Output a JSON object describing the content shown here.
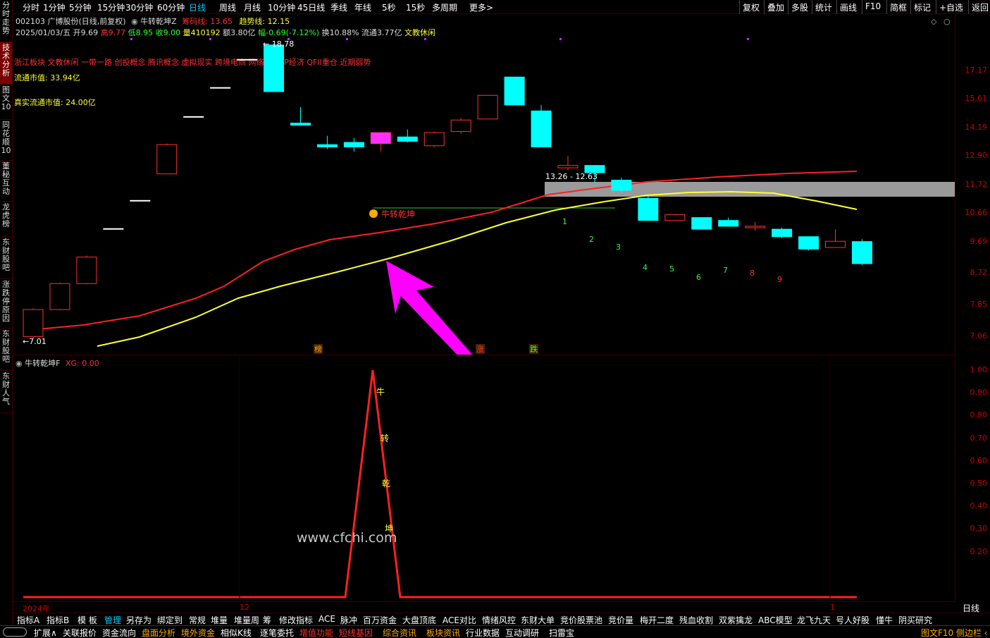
{
  "sidebar": {
    "items": [
      {
        "label": "分时走势",
        "active": false
      },
      {
        "label": "技术分析",
        "active": true
      },
      {
        "label": "图文10",
        "active": false
      },
      {
        "label": "同花顺10",
        "active": false
      },
      {
        "label": "董秘互动",
        "active": false
      },
      {
        "label": "龙虎榜",
        "active": false
      },
      {
        "label": "东财股吧",
        "active": false
      },
      {
        "label": "涨跌停原因",
        "active": false
      },
      {
        "label": "东财股吧",
        "active": false
      },
      {
        "label": "东财人气",
        "active": false
      }
    ]
  },
  "topbar": {
    "periods": [
      "分时",
      "1分钟",
      "5分钟",
      "15分钟",
      "30分钟",
      "60分钟",
      "日线",
      "周线",
      "月线",
      "10分钟",
      "45日线",
      "季线",
      "年线",
      "5秒",
      "15秒",
      "多周期",
      "更多>"
    ],
    "active_period": "日线",
    "right_buttons": [
      "复权",
      "叠加",
      "多股",
      "统计",
      "画线",
      "F10",
      "简框",
      "标记",
      "+自选",
      "返回"
    ]
  },
  "header": {
    "stock": "002103 广博股份(日线,前复权)",
    "indicator_name": "牛转乾坤Z",
    "chip_label": "筹码线: 13.65",
    "trend_label": "趋势线: 12.15",
    "date": "2025/01/03/五",
    "open": "开9.69",
    "high": "高9.77",
    "low": "低8.95",
    "close": "收9.00",
    "volume": "量410192",
    "amount": "额3.80亿",
    "change": "幅-0.69(-7.12%)",
    "turnover": "换10.88%",
    "float": "流通3.77亿",
    "tag": "文教休闲",
    "concepts": "浙江板块 文教休闲 一带一路 创投概念 腾讯概念 虚拟现实 跨境电商 网络概念 IP经济 QFII重仓 近期弱势",
    "float_mv": "流通市值: 33.94亿",
    "real_float_mv": "真实流通市值: 24.00亿"
  },
  "annotations": {
    "high_label": "18.78",
    "low_label": "7.01",
    "box_label": "13.26 - 12.63",
    "signal_label": "牛转乾坤",
    "mark_bang": "榜",
    "mark_zhang": "涨",
    "mark_die": "跌",
    "countdown": [
      "1",
      "2",
      "3",
      "4",
      "5",
      "6",
      "7",
      "8",
      "9"
    ],
    "watermark": "www.cfchi.com",
    "ind_chars": [
      "牛",
      "转",
      "乾",
      "坤"
    ]
  },
  "y_axis_main": [
    "17.17",
    "15.61",
    "14.19",
    "12.90",
    "11.72",
    "10.66",
    "9.69",
    "8.72",
    "7.85",
    "7.06"
  ],
  "y_axis_ind": [
    "1.00",
    "0.90",
    "0.80",
    "0.70",
    "0.60",
    "0.50",
    "0.40",
    "0.30",
    "0.20"
  ],
  "x_axis": {
    "labels": [
      "2024年",
      "12",
      "1"
    ],
    "period": "日线"
  },
  "indicator": {
    "name": "牛转乾坤F",
    "value": "XG: 0.00"
  },
  "candles": [
    {
      "o": 7.05,
      "c": 7.72,
      "h": 7.75,
      "l": 7.01
    },
    {
      "o": 7.72,
      "c": 8.42,
      "h": 8.45,
      "l": 7.7
    },
    {
      "o": 8.42,
      "c": 9.2,
      "h": 9.25,
      "l": 8.4
    },
    {
      "o": 10.1,
      "c": 10.12,
      "h": 10.12,
      "l": 10.1
    },
    {
      "o": 11.1,
      "c": 11.12,
      "h": 11.12,
      "l": 11.1
    },
    {
      "o": 12.15,
      "c": 13.4,
      "h": 13.45,
      "l": 12.15
    },
    {
      "o": 14.7,
      "c": 14.72,
      "h": 14.72,
      "l": 14.7
    },
    {
      "o": 16.2,
      "c": 16.22,
      "h": 16.22,
      "l": 16.2
    },
    {
      "o": 17.8,
      "c": 17.82,
      "h": 17.82,
      "l": 17.8
    },
    {
      "o": 18.7,
      "c": 16.0,
      "h": 18.78,
      "l": 16.0
    },
    {
      "o": 14.4,
      "c": 14.3,
      "h": 15.2,
      "l": 14.3
    },
    {
      "o": 13.4,
      "c": 13.3,
      "h": 13.8,
      "l": 13.2
    },
    {
      "o": 13.5,
      "c": 13.3,
      "h": 13.7,
      "l": 13.1
    },
    {
      "o": 13.45,
      "c": 13.95,
      "h": 13.95,
      "l": 13.1
    },
    {
      "o": 13.75,
      "c": 13.55,
      "h": 14.1,
      "l": 13.5
    },
    {
      "o": 13.35,
      "c": 13.95,
      "h": 14.0,
      "l": 13.3
    },
    {
      "o": 14.0,
      "c": 14.55,
      "h": 14.65,
      "l": 13.9
    },
    {
      "o": 14.6,
      "c": 15.8,
      "h": 15.8,
      "l": 14.6
    },
    {
      "o": 16.8,
      "c": 15.3,
      "h": 16.8,
      "l": 15.3
    },
    {
      "o": 15.0,
      "c": 13.3,
      "h": 15.3,
      "l": 13.3
    },
    {
      "o": 12.4,
      "c": 12.5,
      "h": 12.9,
      "l": 12.3
    },
    {
      "o": 12.5,
      "c": 12.2,
      "h": 12.5,
      "l": 11.8
    },
    {
      "o": 11.9,
      "c": 11.5,
      "h": 12.0,
      "l": 11.4
    },
    {
      "o": 11.2,
      "c": 10.4,
      "h": 11.3,
      "l": 10.4
    },
    {
      "o": 10.4,
      "c": 10.6,
      "h": 10.6,
      "l": 10.4
    },
    {
      "o": 10.5,
      "c": 10.1,
      "h": 10.5,
      "l": 10.1
    },
    {
      "o": 10.4,
      "c": 10.2,
      "h": 10.5,
      "l": 10.2
    },
    {
      "o": 10.15,
      "c": 10.2,
      "h": 10.35,
      "l": 10.05
    },
    {
      "o": 10.1,
      "c": 9.85,
      "h": 10.15,
      "l": 9.8
    },
    {
      "o": 9.85,
      "c": 9.45,
      "h": 9.85,
      "l": 9.4
    },
    {
      "o": 9.5,
      "c": 9.7,
      "h": 10.1,
      "l": 9.5
    },
    {
      "o": 9.69,
      "c": 9.0,
      "h": 9.77,
      "l": 8.95
    }
  ],
  "colors": {
    "up": "#ff3030",
    "down": "#00ffff",
    "chip": "#ff2020",
    "trend": "#ffff30",
    "accent": "#ff00ff"
  }
}
